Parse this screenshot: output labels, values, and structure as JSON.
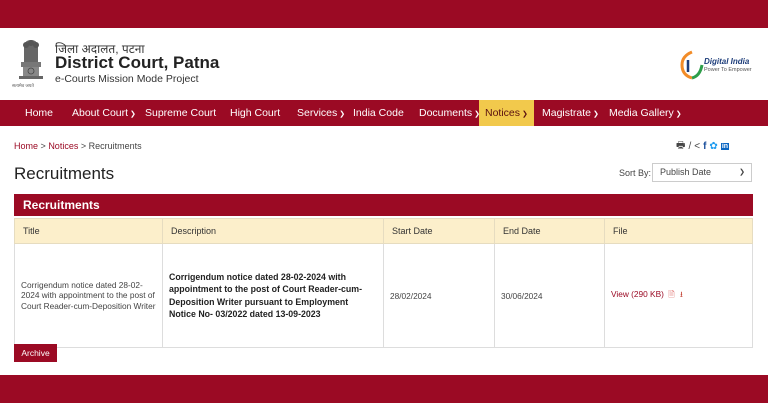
{
  "header": {
    "hindi_name": "जिला अदालत, पटना",
    "court_name": "District Court, Patna",
    "subtitle": "e-Courts Mission Mode Project",
    "emblem_caption": "सत्यमेव जयते",
    "digital_india_title": "Digital India",
    "digital_india_sub": "Power To Empower"
  },
  "nav": {
    "items": [
      {
        "label": "Home",
        "dropdown": false
      },
      {
        "label": "About Court",
        "dropdown": true
      },
      {
        "label": "Supreme Court",
        "dropdown": false
      },
      {
        "label": "High Court",
        "dropdown": false
      },
      {
        "label": "Services",
        "dropdown": true
      },
      {
        "label": "India Code",
        "dropdown": false
      },
      {
        "label": "Documents",
        "dropdown": true
      },
      {
        "label": "Notices",
        "dropdown": true,
        "active": true
      },
      {
        "label": "Magistrate",
        "dropdown": true
      },
      {
        "label": "Media Gallery",
        "dropdown": true
      }
    ]
  },
  "breadcrumb": {
    "home": "Home",
    "notices": "Notices",
    "current": "Recruitments",
    "sep": ">"
  },
  "page": {
    "title": "Recruitments",
    "sort_label": "Sort By:",
    "sort_value": "Publish Date"
  },
  "panel": {
    "title": "Recruitments",
    "columns": [
      "Title",
      "Description",
      "Start Date",
      "End Date",
      "File"
    ],
    "rows": [
      {
        "title": "Corrigendum notice dated 28-02-2024 with appointment to the post of Court Reader-cum-Deposition Writer",
        "description": "Corrigendum notice dated 28-02-2024 with appointment to the post of Court Reader-cum-Deposition Writer pursuant to Employment Notice No- 03/2022 dated 13-09-2023",
        "start_date": "28/02/2024",
        "end_date": "30/06/2024",
        "file_link": "View (290 KB)"
      }
    ]
  },
  "archive_label": "Archive",
  "colors": {
    "brand": "#9b0a24",
    "active_nav": "#f2c94c",
    "table_header": "#fcefcb"
  },
  "icons": [
    "print-icon",
    "share-icon",
    "facebook-icon",
    "twitter-icon",
    "linkedin-icon",
    "pdf-icon",
    "download-icon",
    "chevron-down-icon"
  ]
}
